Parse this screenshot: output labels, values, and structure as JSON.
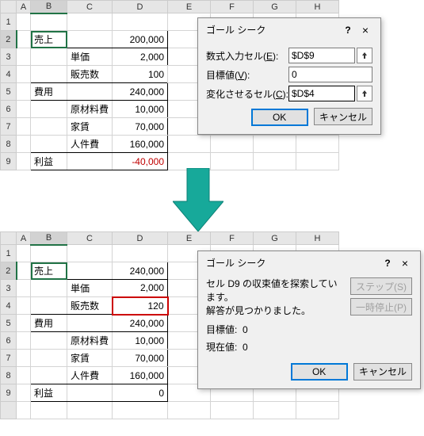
{
  "columns": [
    "A",
    "B",
    "C",
    "D",
    "E",
    "F",
    "G",
    "H"
  ],
  "sheet1": {
    "rows": [
      "1",
      "2",
      "3",
      "4",
      "5",
      "6",
      "7",
      "8",
      "9"
    ],
    "b2": "売上",
    "d2": "200,000",
    "c3": "単価",
    "d3": "2,000",
    "c4": "販売数",
    "d4": "100",
    "b5": "費用",
    "d5": "240,000",
    "c6": "原材料費",
    "d6": "10,000",
    "c7": "家賃",
    "d7": "70,000",
    "c8": "人件費",
    "d8": "160,000",
    "b9": "利益",
    "d9": "-40,000"
  },
  "sheet2": {
    "rows": [
      "1",
      "2",
      "3",
      "4",
      "5",
      "6",
      "7",
      "8",
      "9"
    ],
    "b2": "売上",
    "d2": "240,000",
    "c3": "単価",
    "d3": "2,000",
    "c4": "販売数",
    "d4": "120",
    "b5": "費用",
    "d5": "240,000",
    "c6": "原材料費",
    "d6": "10,000",
    "c7": "家賃",
    "d7": "70,000",
    "c8": "人件費",
    "d8": "160,000",
    "b9": "利益",
    "d9": "0"
  },
  "dialog1": {
    "title": "ゴール シーク",
    "help": "?",
    "close": "×",
    "formula_label_pre": "数式入力セル(",
    "formula_label_u": "E",
    "formula_label_post": "):",
    "formula_value": "$D$9",
    "target_label_pre": "目標値(",
    "target_label_u": "V",
    "target_label_post": "):",
    "target_value": "0",
    "change_label_pre": "変化させるセル(",
    "change_label_u": "C",
    "change_label_post": "):",
    "change_value": "$D$4",
    "ok": "OK",
    "cancel": "キャンセル"
  },
  "dialog2": {
    "title": "ゴール シーク",
    "help": "?",
    "close": "×",
    "msg1": "セル D9 の収束値を探索しています。",
    "msg2": "解答が見つかりました。",
    "target_label": "目標値:",
    "target_value": "0",
    "current_label": "現在値:",
    "current_value": "0",
    "step": "ステップ(S)",
    "pause": "一時停止(P)",
    "ok": "OK",
    "cancel": "キャンセル"
  }
}
